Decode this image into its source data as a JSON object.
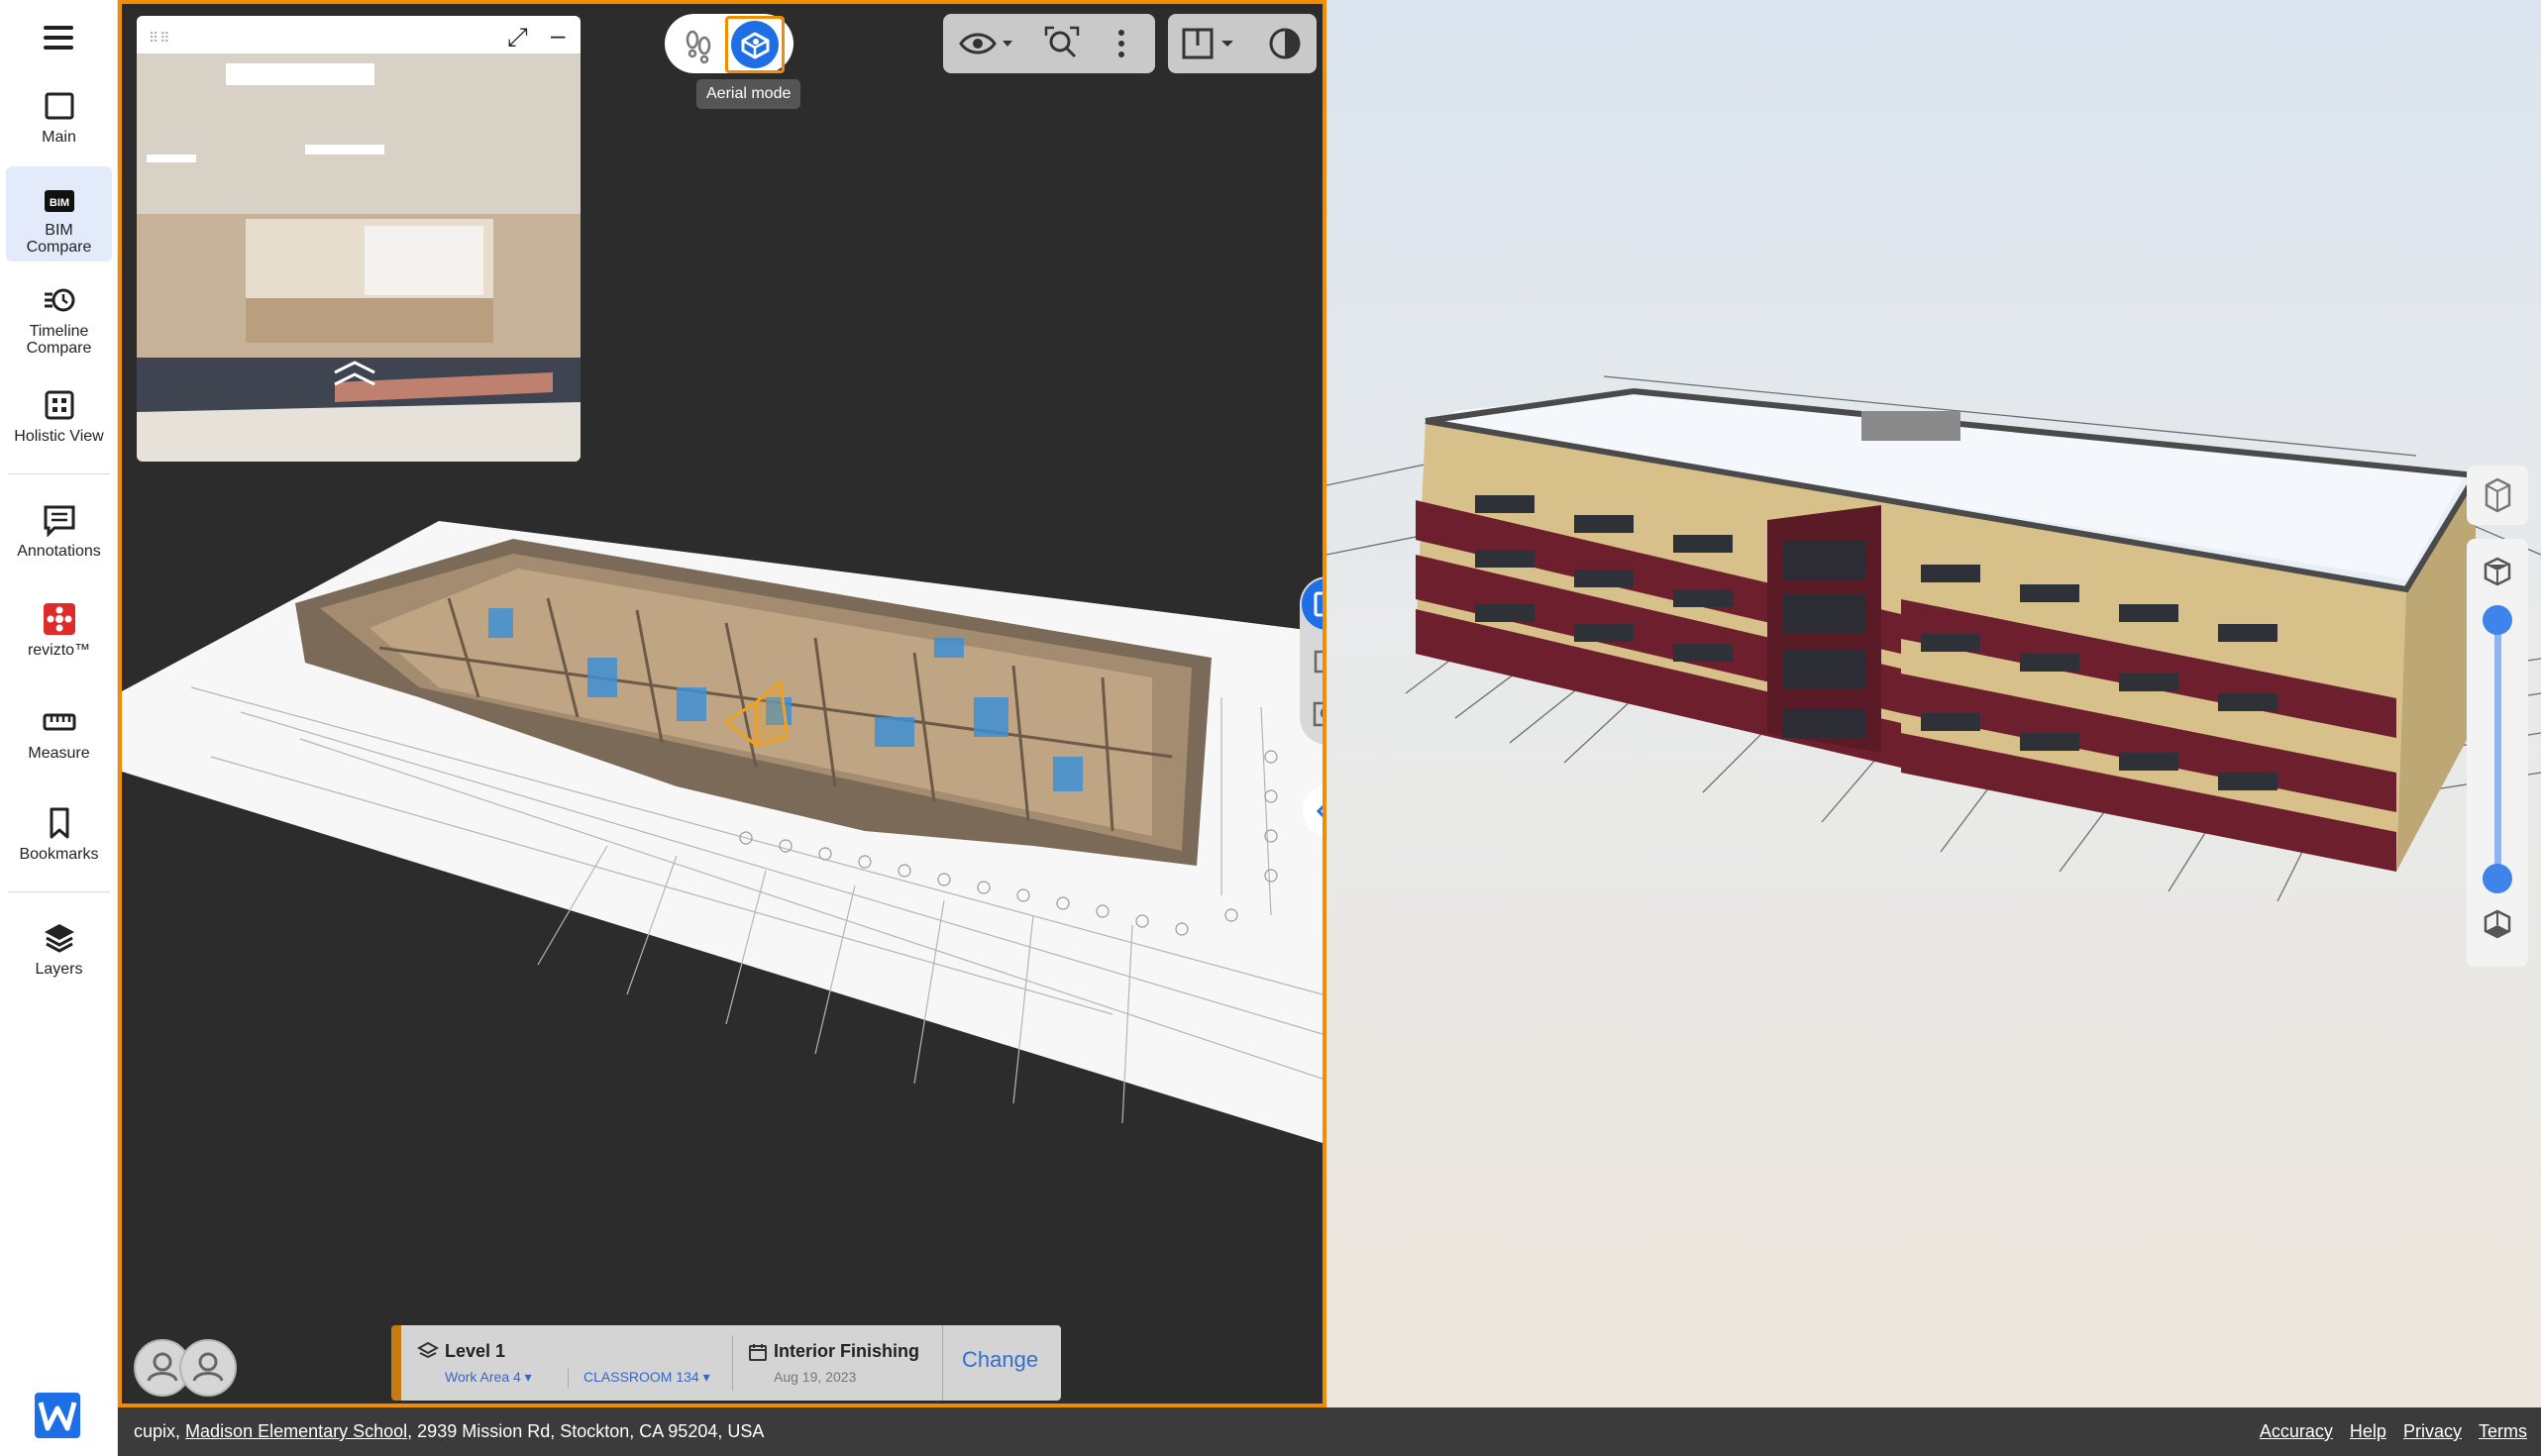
{
  "sidebar": {
    "items": [
      {
        "label": "Main",
        "icon": "square-icon"
      },
      {
        "label": "BIM Compare",
        "icon": "bim-icon",
        "active": true,
        "badge": "BIM"
      },
      {
        "label": "Timeline Compare",
        "icon": "timeline-icon"
      },
      {
        "label": "Holistic View",
        "icon": "grid-icon"
      },
      {
        "label": "Annotations",
        "icon": "annotation-icon"
      },
      {
        "label": "revizto™",
        "icon": "revizto-icon"
      },
      {
        "label": "Measure",
        "icon": "ruler-icon"
      },
      {
        "label": "Bookmarks",
        "icon": "bookmark-icon"
      },
      {
        "label": "Layers",
        "icon": "layers-icon"
      }
    ]
  },
  "viewer": {
    "tooltip": "Aerial mode",
    "accent_color": "#f28c00",
    "active_mode_color": "#1e6fe6"
  },
  "level_panel": {
    "level": "Level 1",
    "work_area": "Work Area 4",
    "room": "CLASSROOM 134",
    "phase": "Interior Finishing",
    "date": "Aug 19, 2023",
    "change_label": "Change"
  },
  "footer": {
    "prefix": "cupix,",
    "project_link": "Madison Elementary School",
    "address": ", 2939 Mission Rd, Stockton, CA 95204, USA",
    "links": [
      "Accuracy",
      "Help",
      "Privacy",
      "Terms"
    ]
  }
}
